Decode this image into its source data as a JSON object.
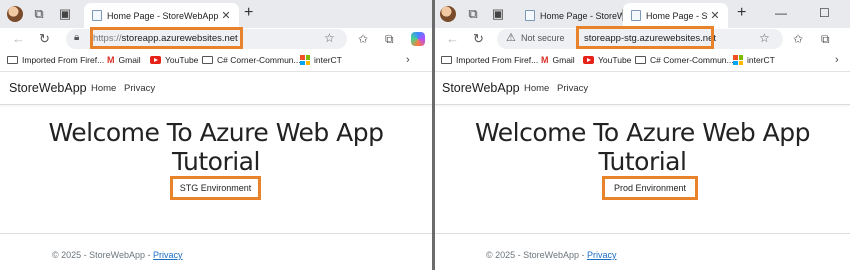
{
  "left": {
    "tabs": [
      {
        "title": "Home Page - StoreWebApp",
        "active": true
      }
    ],
    "address": {
      "scheme": "https://",
      "host": "storeapp.azurewebsites.net"
    },
    "bookmarks": [
      "Imported From Firef...",
      "Gmail",
      "YouTube",
      "C# Corner-Commun...",
      "interCT"
    ],
    "brand": "StoreWebApp",
    "nav": [
      "Home",
      "Privacy"
    ],
    "welcome_line1": "Welcome To Azure Web App",
    "welcome_line2": "Tutorial",
    "environment": "STG Environment",
    "footer_text": "© 2025 - StoreWebApp -",
    "footer_link": "Privacy"
  },
  "right": {
    "tabs": [
      {
        "title": "Home Page - StoreW",
        "active": false
      },
      {
        "title": "Home Page - StoreW",
        "active": true
      }
    ],
    "security_label": "Not secure",
    "address": {
      "host": "storeapp-stg.azurewebsites.net"
    },
    "bookmarks": [
      "Imported From Firef...",
      "Gmail",
      "YouTube",
      "C# Corner-Commun...",
      "interCT"
    ],
    "brand": "StoreWebApp",
    "nav": [
      "Home",
      "Privacy"
    ],
    "welcome_line1": "Welcome To Azure Web App",
    "welcome_line2": "Tutorial",
    "environment": "Prod Environment",
    "footer_text": "© 2025 - StoreWebApp -",
    "footer_link": "Privacy"
  },
  "colors": {
    "highlight": "#e8822b",
    "link": "#1b6ec2",
    "tabstrip": "#e9eaed"
  },
  "icons": [
    "avatar",
    "workspaces-icon",
    "tab-actions-icon",
    "close-icon",
    "new-tab-icon",
    "back-icon",
    "refresh-icon",
    "lock-icon",
    "favorite-star-icon",
    "favorites-icon",
    "copilot-icon",
    "folder-icon",
    "gmail-icon",
    "youtube-icon",
    "microsoft-icon",
    "chevron-right-icon",
    "minimize-icon",
    "maximize-icon"
  ]
}
